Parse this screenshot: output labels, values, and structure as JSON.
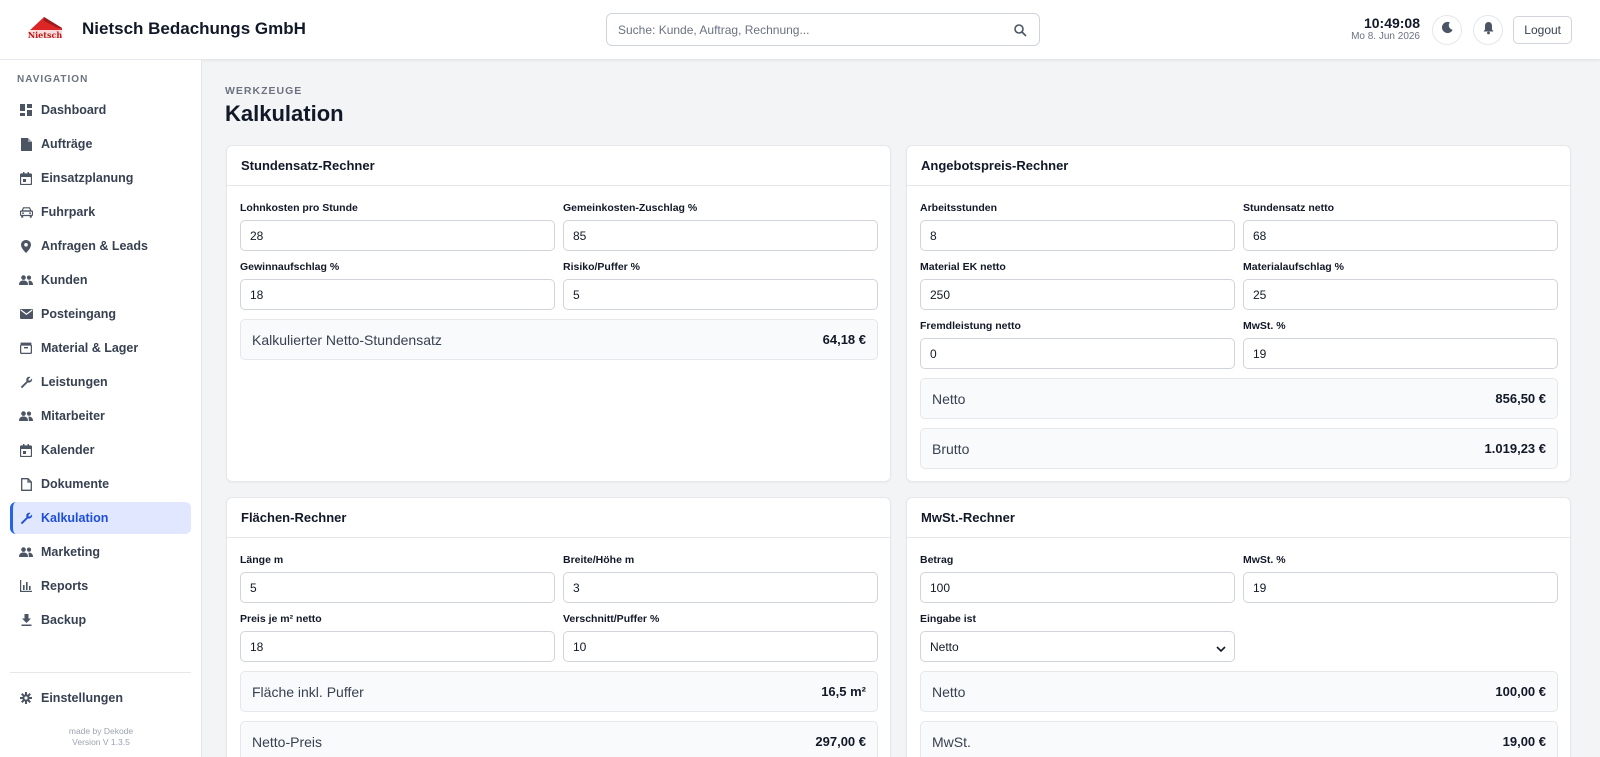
{
  "header": {
    "logo_text": "Nietsch",
    "company": "Nietsch Bedachungs GmbH",
    "search_placeholder": "Suche: Kunde, Auftrag, Rechnung...",
    "time": "10:49:08",
    "date": "Mo 8. Jun 2026",
    "logout_label": "Logout"
  },
  "sidebar": {
    "title": "NAVIGATION",
    "items": [
      {
        "label": "Dashboard",
        "icon": "dashboard-icon"
      },
      {
        "label": "Aufträge",
        "icon": "document-icon"
      },
      {
        "label": "Einsatzplanung",
        "icon": "calendar-icon"
      },
      {
        "label": "Fuhrpark",
        "icon": "car-icon"
      },
      {
        "label": "Anfragen & Leads",
        "icon": "location-pin-icon"
      },
      {
        "label": "Kunden",
        "icon": "people-icon"
      },
      {
        "label": "Posteingang",
        "icon": "mail-icon"
      },
      {
        "label": "Material & Lager",
        "icon": "box-icon"
      },
      {
        "label": "Leistungen",
        "icon": "wrench-icon"
      },
      {
        "label": "Mitarbeiter",
        "icon": "people-icon"
      },
      {
        "label": "Kalender",
        "icon": "calendar-icon"
      },
      {
        "label": "Dokumente",
        "icon": "file-icon"
      },
      {
        "label": "Kalkulation",
        "icon": "wrench-icon"
      },
      {
        "label": "Marketing",
        "icon": "people-icon"
      },
      {
        "label": "Reports",
        "icon": "bar-chart-icon"
      },
      {
        "label": "Backup",
        "icon": "download-icon"
      }
    ],
    "active": "Kalkulation",
    "settings_label": "Einstellungen",
    "made_by": "made by Dekode",
    "version": "Version V 1.3.5"
  },
  "page": {
    "kicker": "WERKZEUGE",
    "title": "Kalkulation"
  },
  "stundensatz": {
    "title": "Stundensatz-Rechner",
    "lohn_label": "Lohnkosten pro Stunde",
    "lohn_value": "28",
    "gemein_label": "Gemeinkosten-Zuschlag %",
    "gemein_value": "85",
    "gewinn_label": "Gewinnaufschlag %",
    "gewinn_value": "18",
    "risiko_label": "Risiko/Puffer %",
    "risiko_value": "5",
    "result_label": "Kalkulierter Netto-Stundensatz",
    "result_value": "64,18 €"
  },
  "angebot": {
    "title": "Angebotspreis-Rechner",
    "stunden_label": "Arbeitsstunden",
    "stunden_value": "8",
    "satz_label": "Stundensatz netto",
    "satz_value": "68",
    "material_label": "Material EK netto",
    "material_value": "250",
    "aufschlag_label": "Materialaufschlag %",
    "aufschlag_value": "25",
    "fremd_label": "Fremdleistung netto",
    "fremd_value": "0",
    "mwst_label": "MwSt. %",
    "mwst_value": "19",
    "netto_label": "Netto",
    "netto_value": "856,50 €",
    "brutto_label": "Brutto",
    "brutto_value": "1.019,23 €"
  },
  "flaechen": {
    "title": "Flächen-Rechner",
    "laenge_label": "Länge m",
    "laenge_value": "5",
    "breite_label": "Breite/Höhe m",
    "breite_value": "3",
    "preis_label": "Preis je m² netto",
    "preis_value": "18",
    "verschnitt_label": "Verschnitt/Puffer %",
    "verschnitt_value": "10",
    "flaeche_label": "Fläche inkl. Puffer",
    "flaeche_value": "16,5 m²",
    "nettopreis_label": "Netto-Preis",
    "nettopreis_value": "297,00 €"
  },
  "mwst": {
    "title": "MwSt.-Rechner",
    "betrag_label": "Betrag",
    "betrag_value": "100",
    "mwst_label": "MwSt. %",
    "mwst_value": "19",
    "eingabe_label": "Eingabe ist",
    "eingabe_selected": "Netto",
    "netto_label": "Netto",
    "netto_value": "100,00 €",
    "mwst_result_label": "MwSt.",
    "mwst_result_value": "19,00 €"
  },
  "colors": {
    "accent": "#2563eb",
    "active_bg": "#e0e7ff",
    "logo_red": "#dc2626"
  }
}
